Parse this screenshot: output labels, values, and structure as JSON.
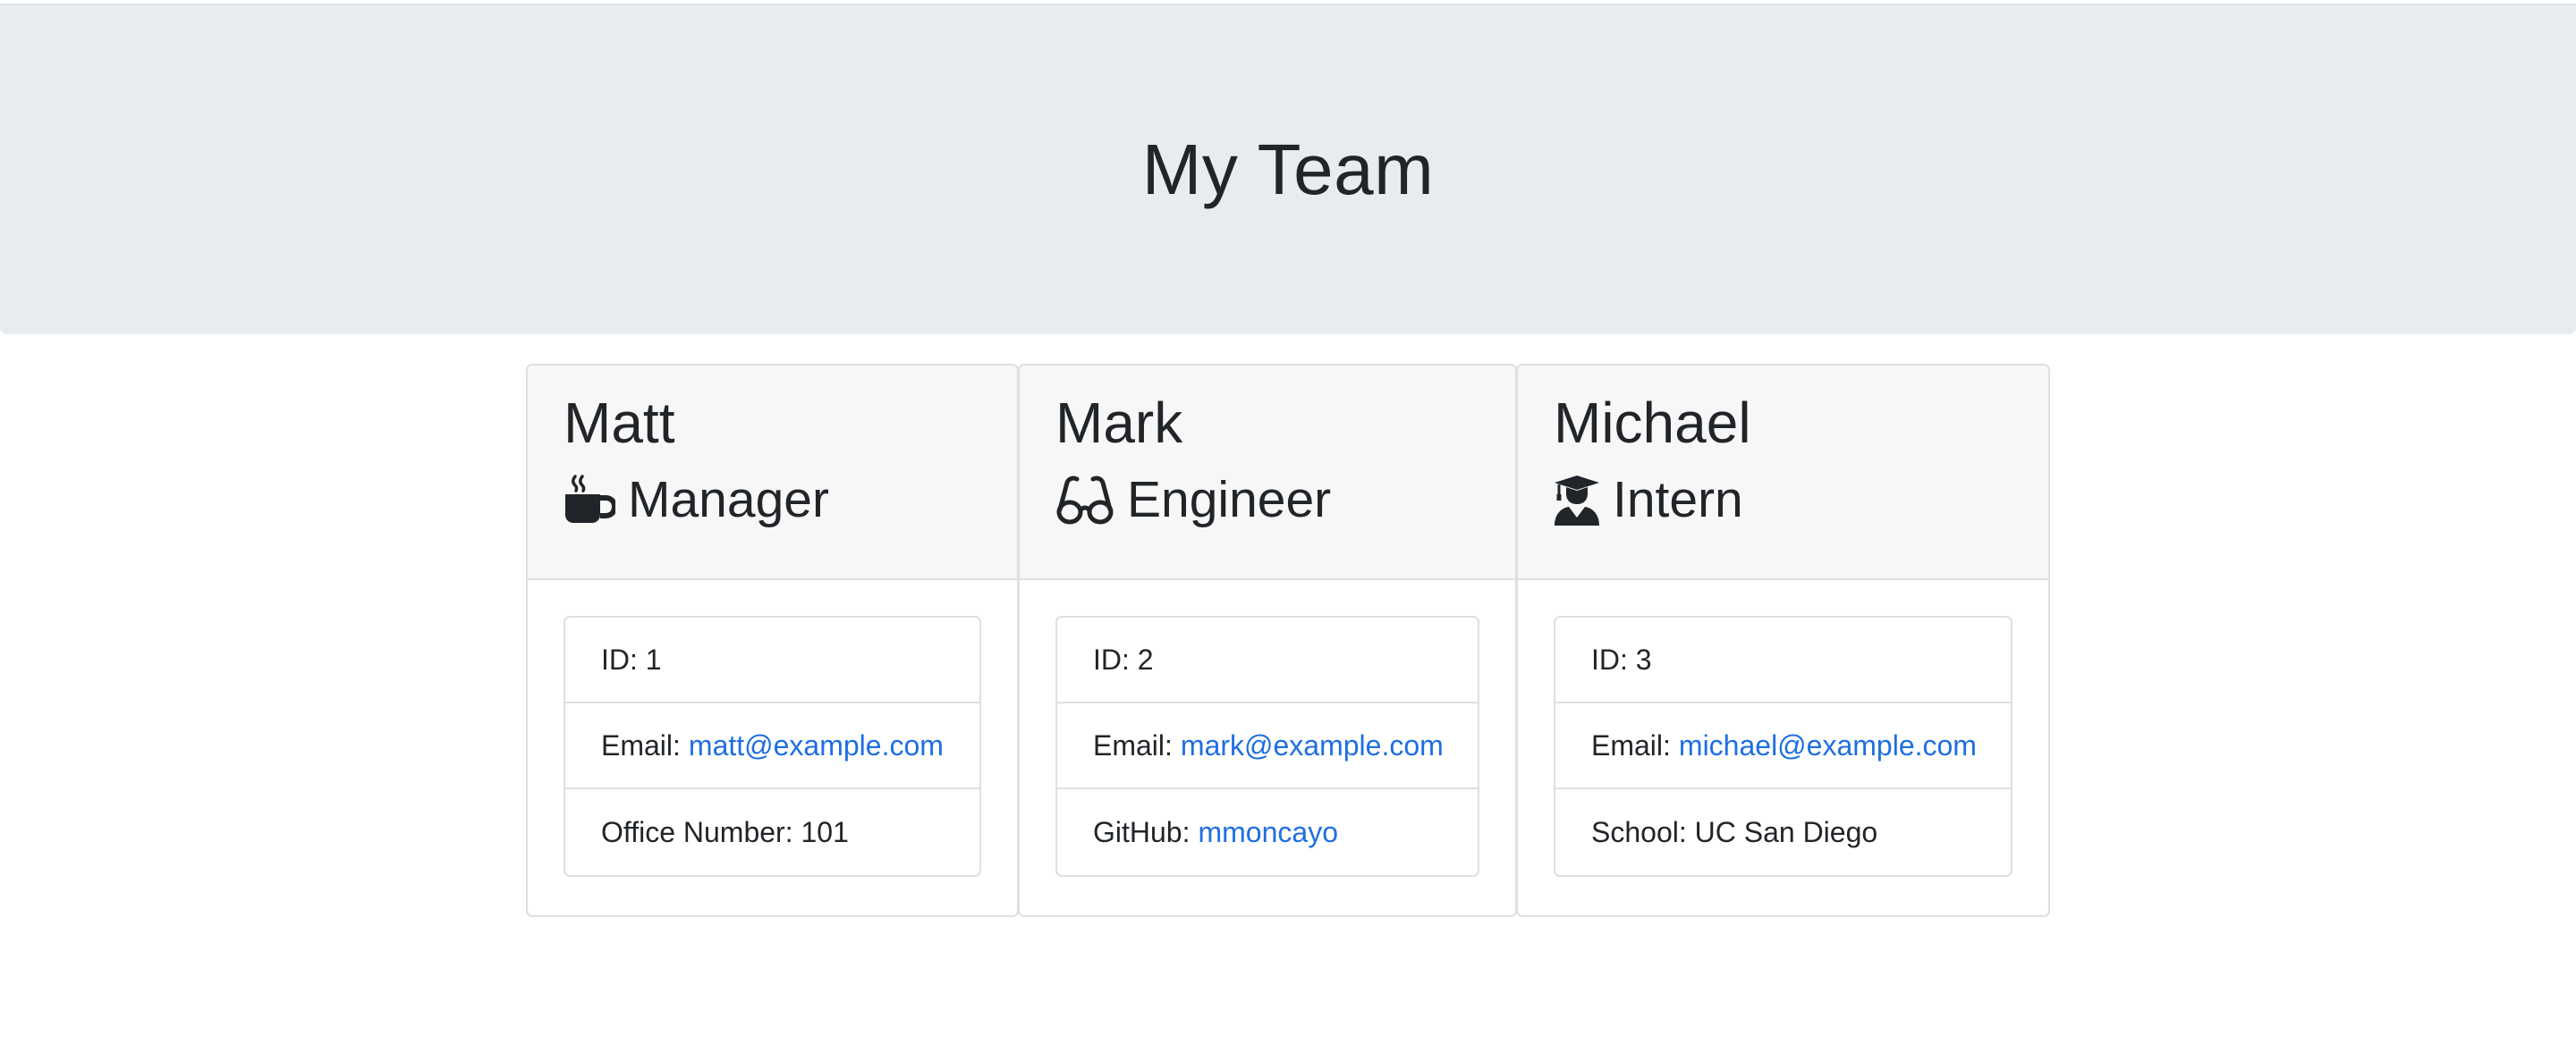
{
  "page_title": "My Team",
  "colors": {
    "header_bg": "#e9ecef",
    "card_header_bg": "#f7f7f7",
    "border": "#dfdfdf",
    "link": "#1e6fe0",
    "text": "#212529"
  },
  "team": [
    {
      "name": "Matt",
      "role": "Manager",
      "icon": "coffee-mug-icon",
      "id_label": "ID: 1",
      "email_prefix": "Email:",
      "email": "matt@example.com",
      "extra_prefix": "Office Number: 101",
      "extra_link": ""
    },
    {
      "name": "Mark",
      "role": "Engineer",
      "icon": "glasses-icon",
      "id_label": "ID: 2",
      "email_prefix": "Email:",
      "email": "mark@example.com",
      "extra_prefix": "GitHub:",
      "extra_link": "mmoncayo"
    },
    {
      "name": "Michael",
      "role": "Intern",
      "icon": "graduate-icon",
      "id_label": "ID: 3",
      "email_prefix": "Email:",
      "email": "michael@example.com",
      "extra_prefix": "School: UC San Diego",
      "extra_link": ""
    }
  ]
}
